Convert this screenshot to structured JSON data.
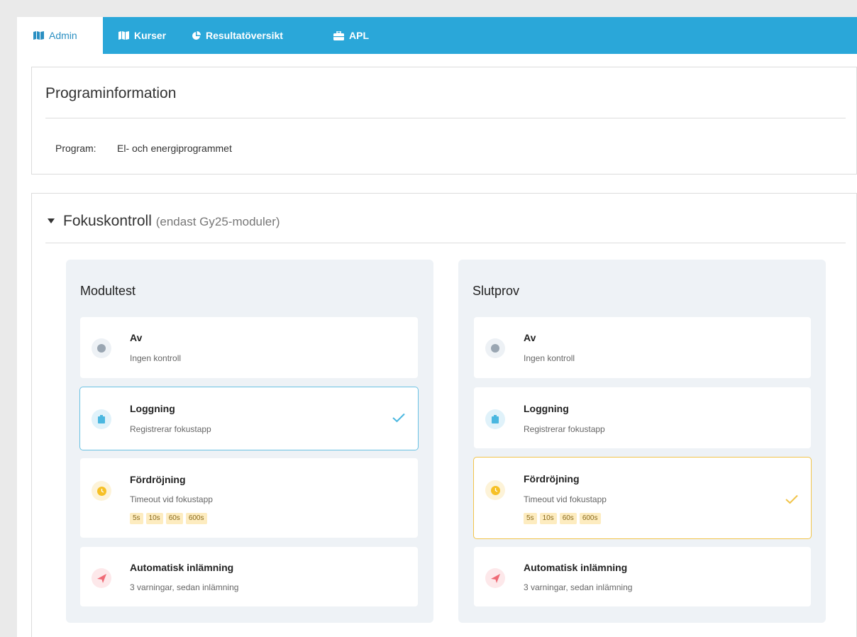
{
  "nav": {
    "tabs": [
      {
        "label": "Admin",
        "icon": "map-icon"
      },
      {
        "label": "Kurser",
        "icon": "map-icon"
      },
      {
        "label": "Resultatöversikt",
        "icon": "pie-chart-icon"
      },
      {
        "label": "APL",
        "icon": "briefcase-icon"
      }
    ],
    "active_tab": "Admin"
  },
  "program_info": {
    "title": "Programinformation",
    "program_label": "Program:",
    "program_value": "El- och energiprogrammet"
  },
  "fokus": {
    "title": "Fokuskontroll",
    "subtitle": "(endast Gy25-moduler)",
    "columns": [
      {
        "title": "Modultest",
        "selected": "Loggning",
        "options": [
          {
            "name": "Av",
            "desc": "Ingen kontroll"
          },
          {
            "name": "Loggning",
            "desc": "Registrerar fokustapp"
          },
          {
            "name": "Fördröjning",
            "desc": "Timeout vid fokustapp",
            "chips": [
              "5s",
              "10s",
              "60s",
              "600s"
            ]
          },
          {
            "name": "Automatisk inlämning",
            "desc": "3 varningar, sedan inlämning"
          }
        ]
      },
      {
        "title": "Slutprov",
        "selected": "Fördröjning",
        "options": [
          {
            "name": "Av",
            "desc": "Ingen kontroll"
          },
          {
            "name": "Loggning",
            "desc": "Registrerar fokustapp"
          },
          {
            "name": "Fördröjning",
            "desc": "Timeout vid fokustapp",
            "chips": [
              "5s",
              "10s",
              "60s",
              "600s"
            ]
          },
          {
            "name": "Automatisk inlämning",
            "desc": "3 varningar, sedan inlämning"
          }
        ]
      }
    ]
  },
  "colors": {
    "nav_bg": "#2aa7d9",
    "accent_blue": "#2a8fc2",
    "selected_blue_border": "#69c1e3",
    "selected_yellow_border": "#f1c44a",
    "chip_bg": "#fdecc0"
  }
}
